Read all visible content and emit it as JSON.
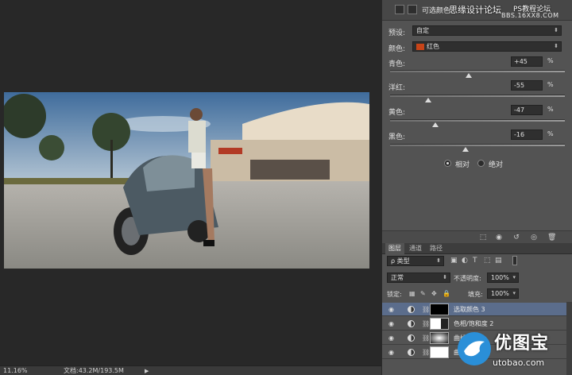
{
  "properties": {
    "title": "可选颜色",
    "preset_label": "预设:",
    "preset_value": "自定",
    "colors_label": "颜色:",
    "colors_value": "红色",
    "colors_swatch": "#c84418",
    "sliders": [
      {
        "label": "青色:",
        "value": "+45",
        "percent": "%",
        "pos": 0.45
      },
      {
        "label": "洋红:",
        "value": "-55",
        "percent": "%",
        "pos": 0.22
      },
      {
        "label": "黄色:",
        "value": "-47",
        "percent": "%",
        "pos": 0.26
      },
      {
        "label": "黑色:",
        "value": "-16",
        "percent": "%",
        "pos": 0.43
      }
    ],
    "method_relative": "相对",
    "method_absolute": "绝对"
  },
  "watermark": {
    "title": "思缘设计论坛",
    "ps_text": "PS教程论坛",
    "sub": "BBS.16XX8.COM"
  },
  "layers_panel": {
    "tabs": [
      "图层",
      "通道",
      "路径"
    ],
    "filter_label": "ρ 类型",
    "blend_mode": "正常",
    "opacity_label": "不透明度:",
    "opacity_value": "100%",
    "lock_label": "锁定:",
    "fill_label": "填充:",
    "fill_value": "100%",
    "layers": [
      {
        "name": "选取颜色 3",
        "selected": true
      },
      {
        "name": "色相/饱和度 2",
        "selected": false
      },
      {
        "name": "曲线 3",
        "selected": false
      },
      {
        "name": "曲线 2",
        "selected": false
      }
    ]
  },
  "status": {
    "zoom": "11.16%",
    "doc": "文档:43.2M/193.5M"
  },
  "logo": {
    "text": "优图宝",
    "url": "utobao.com"
  }
}
